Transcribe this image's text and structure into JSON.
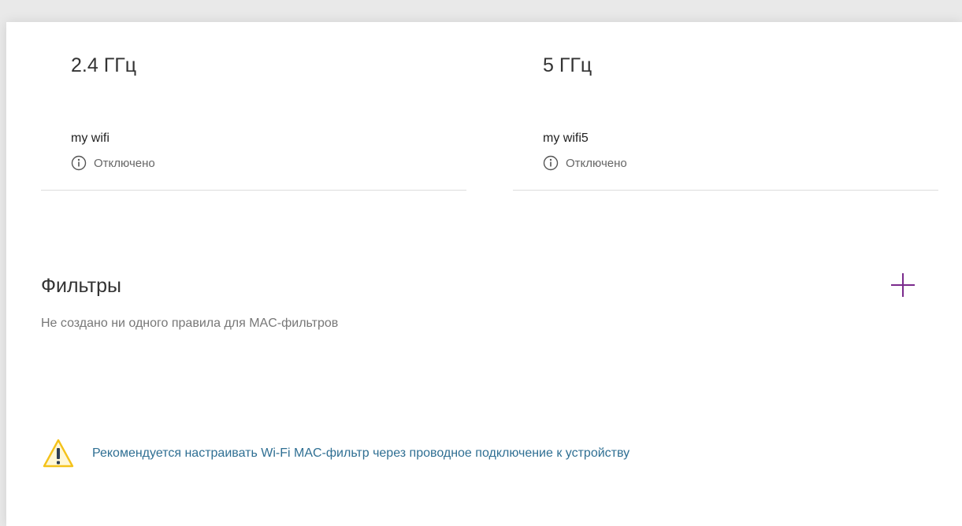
{
  "bands": [
    {
      "title": "2.4 ГГц",
      "ssid": "my wifi",
      "status": "Отключено",
      "status_icon": "info-icon"
    },
    {
      "title": "5 ГГц",
      "ssid": "my wifi5",
      "status": "Отключено",
      "status_icon": "info-icon"
    }
  ],
  "filters": {
    "title": "Фильтры",
    "empty_message": "Не создано ни одного правила для MAC-фильтров",
    "add_icon": "plus-icon",
    "accent_color": "#7a2a8c"
  },
  "warning": {
    "icon": "warning-triangle-icon",
    "text": "Рекомендуется настраивать Wi-Fi MAC-фильтр через проводное подключение к устройству",
    "text_color": "#2f6f93",
    "icon_color": "#f4c21a"
  }
}
